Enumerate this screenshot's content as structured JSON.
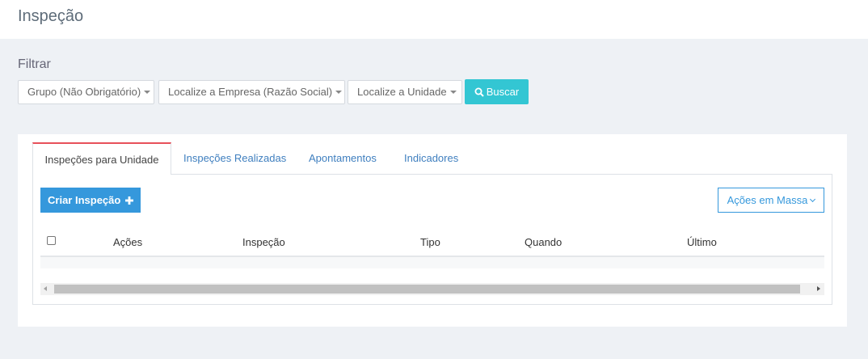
{
  "header": {
    "title": "Inspeção"
  },
  "filter": {
    "label": "Filtrar",
    "grupo": "Grupo (Não Obrigatório)",
    "empresa": "Localize a Empresa (Razão Social)",
    "unidade": "Localize a Unidade",
    "buscar": "Buscar"
  },
  "tabs": [
    {
      "label": "Inspeções para Unidade",
      "active": true
    },
    {
      "label": "Inspeções Realizadas",
      "active": false
    },
    {
      "label": "Apontamentos",
      "active": false
    },
    {
      "label": "Indicadores",
      "active": false
    }
  ],
  "toolbar": {
    "criar": "Criar Inspeção",
    "acoes_massa": "Ações em Massa"
  },
  "table": {
    "columns": [
      "Ações",
      "Inspeção",
      "Tipo",
      "Quando",
      "Último"
    ]
  },
  "colors": {
    "accent": "#3598dc",
    "buscar": "#33c6d3",
    "active_tab": "#e7505a"
  }
}
